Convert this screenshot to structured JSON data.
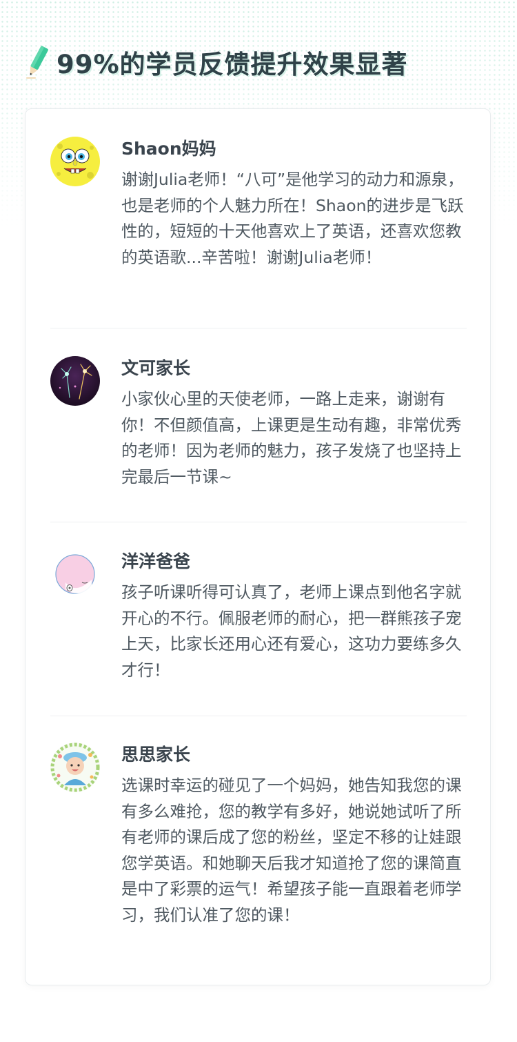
{
  "header": {
    "title": "99%的学员反馈提升效果显著",
    "icon": "pencil-icon",
    "accent_color": "#3cc99a"
  },
  "reviews": [
    {
      "name": "Shaon妈妈",
      "avatar": "sponge-avatar-icon",
      "comment": "谢谢Julia老师！“八可”是他学习的动力和源泉，也是老师的个人魅力所在！Shaon的进步是飞跃性的，短短的十天他喜欢上了英语，还喜欢您教的英语歌...辛苦啦！谢谢Julia老师！"
    },
    {
      "name": "文可家长",
      "avatar": "fireworks-avatar-icon",
      "comment": "小家伙心里的天使老师，一路上走来，谢谢有你！不但颜值高，上课更是生动有趣，非常优秀的老师！因为老师的魅力，孩子发烧了也坚持上完最后一节课~"
    },
    {
      "name": "洋洋爸爸",
      "avatar": "cartoon-baby-avatar-icon",
      "comment": "孩子听课听得可认真了，老师上课点到他名字就开心的不行。佩服老师的耐心，把一群熊孩子宠上天，比家长还用心还有爱心，这功力要练多久才行！"
    },
    {
      "name": "思思家长",
      "avatar": "child-photo-avatar-icon",
      "comment": "选课时幸运的碰见了一个妈妈，她告知我您的课有多么难抢，您的教学有多好，她说她试听了所有老师的课后成了您的粉丝，坚定不移的让娃跟您学英语。和她聊天后我才知道抢了您的课简直是中了彩票的运气！希望孩子能一直跟着老师学习，我们认准了您的课！"
    }
  ]
}
